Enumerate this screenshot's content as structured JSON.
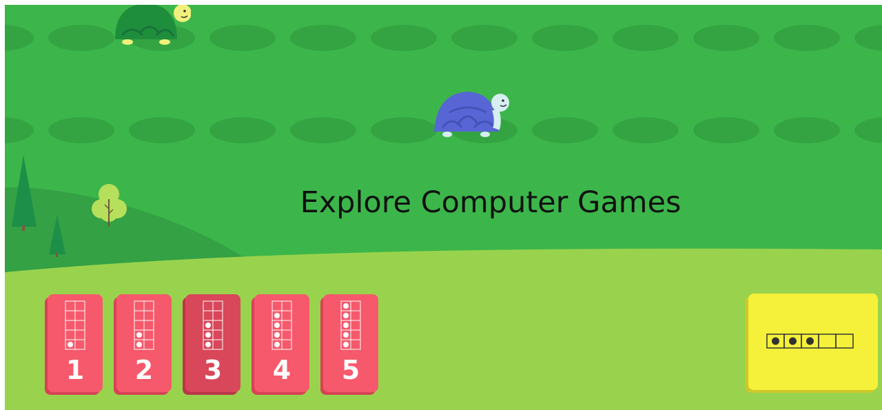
{
  "headline": "Explore Computer Games",
  "colors": {
    "grass": "#3cb64a",
    "hill": "#33a144",
    "meadow": "#99d34d",
    "card": "#f6596b",
    "card_selected": "#d9475a",
    "answer_box": "#f5f13a"
  },
  "turtles": [
    {
      "name": "green-turtle",
      "shell": "#1f8e3c",
      "head": "#f2f07c"
    },
    {
      "name": "blue-turtle",
      "shell": "#5766d4",
      "head": "#d6eef2"
    }
  ],
  "cards": [
    {
      "label": "1",
      "dots": 1,
      "selected": false
    },
    {
      "label": "2",
      "dots": 2,
      "selected": false
    },
    {
      "label": "3",
      "dots": 3,
      "selected": true
    },
    {
      "label": "4",
      "dots": 4,
      "selected": false
    },
    {
      "label": "5",
      "dots": 5,
      "selected": false
    }
  ],
  "answer_frame": {
    "cells": 5,
    "filled": 3
  }
}
